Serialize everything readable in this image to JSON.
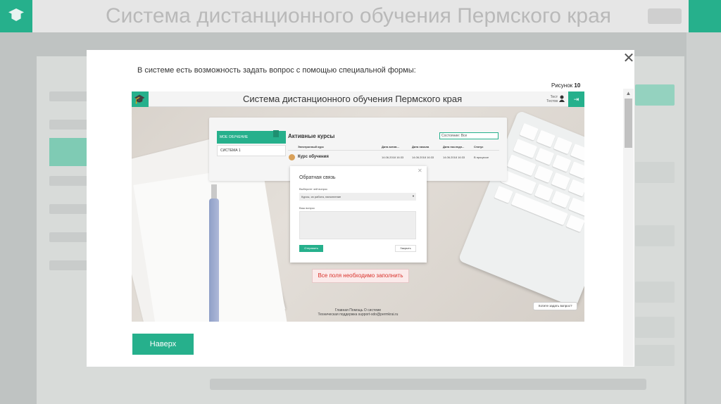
{
  "intro": "В системе есть возможность задать вопрос с помощью специальной формы:",
  "caption": {
    "prefix": "Рисунок",
    "number": "10"
  },
  "close_glyph": "✕",
  "up_button": "Наверх",
  "screenshot": {
    "title": "Система дистанционного обучения Пермского края",
    "user_line1": "Тест",
    "user_line2": "Тестов",
    "courses": {
      "side_active": "МОЕ ОБУЧЕНИЕ",
      "side_item": "СИСТЕМА 1",
      "title": "Активные курсы",
      "filter": "Состояние: Все",
      "columns": [
        "Электронный курс",
        "Дата актив...",
        "Дата начала",
        "Дата последн...",
        "Статус"
      ],
      "row": {
        "name": "Курс обучения",
        "date_active": "14.06.2018 16:33",
        "date_start": "14.06.2018 16:33",
        "date_last": "14.06.2018 16:33",
        "status": "В процессе"
      }
    },
    "feedback": {
      "title": "Обратная связь",
      "topic_label": "Выберите чей вопрос",
      "topic_value": "Курсы, их работа, наполнение",
      "question_label": "Ваш вопрос",
      "send": "Отправить",
      "cancel": "Закрыть"
    },
    "error": "Все поля необходимо заполнить",
    "ask_button": "Хотите задать вопрос?",
    "footer_links": "Главная   Помощь   О системе",
    "footer_support": "Техническая поддержка   support-sdo@permkrai.ru"
  },
  "colors": {
    "accent": "#26b08c",
    "error": "#d9322b"
  },
  "icons": [
    "close-icon",
    "graduation-cap-icon",
    "user-icon",
    "logout-icon"
  ]
}
